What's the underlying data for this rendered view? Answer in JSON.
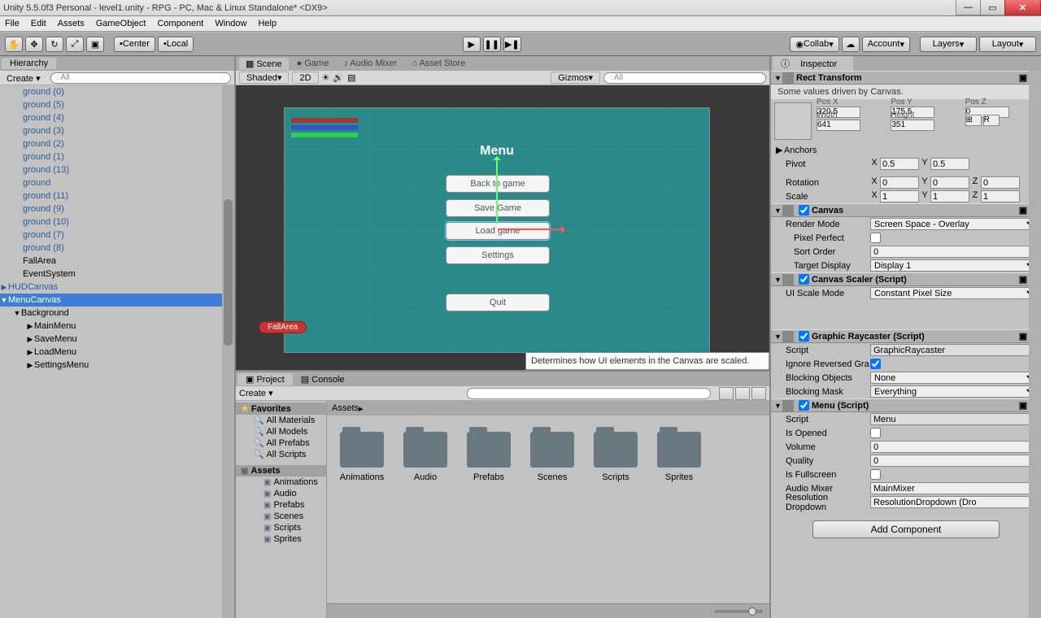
{
  "title": "Unity 5.5.0f3 Personal - level1.unity - RPG - PC, Mac & Linux Standalone* <DX9>",
  "menubar": [
    "File",
    "Edit",
    "Assets",
    "GameObject",
    "Component",
    "Window",
    "Help"
  ],
  "toolbar": {
    "center": "Center",
    "local": "Local",
    "collab": "Collab",
    "account": "Account",
    "layers": "Layers",
    "layout": "Layout"
  },
  "hierarchy": {
    "tab": "Hierarchy",
    "create": "Create",
    "search_ph": "All",
    "items": [
      {
        "t": "ground (0)",
        "c": "prefab",
        "i": 1
      },
      {
        "t": "ground (5)",
        "c": "prefab",
        "i": 1
      },
      {
        "t": "ground (4)",
        "c": "prefab",
        "i": 1
      },
      {
        "t": "ground (3)",
        "c": "prefab",
        "i": 1
      },
      {
        "t": "ground (2)",
        "c": "prefab",
        "i": 1
      },
      {
        "t": "ground (1)",
        "c": "prefab",
        "i": 1
      },
      {
        "t": "ground (13)",
        "c": "prefab",
        "i": 1
      },
      {
        "t": "ground",
        "c": "prefab",
        "i": 1
      },
      {
        "t": "ground (11)",
        "c": "prefab",
        "i": 1
      },
      {
        "t": "ground (9)",
        "c": "prefab",
        "i": 1
      },
      {
        "t": "ground (10)",
        "c": "prefab",
        "i": 1
      },
      {
        "t": "ground (7)",
        "c": "prefab",
        "i": 1
      },
      {
        "t": "ground (8)",
        "c": "prefab",
        "i": 1
      },
      {
        "t": "FallArea",
        "i": 1
      },
      {
        "t": "EventSystem",
        "i": 1
      },
      {
        "t": "HUDCanvas",
        "c": "prefab",
        "i": 0,
        "a": "▶"
      },
      {
        "t": "MenuCanvas",
        "i": 0,
        "a": "▼",
        "sel": true
      },
      {
        "t": "Background",
        "i": 1,
        "a": "▼"
      },
      {
        "t": "MainMenu",
        "i": 2,
        "a": "▶"
      },
      {
        "t": "SaveMenu",
        "i": 2,
        "a": "▶"
      },
      {
        "t": "LoadMenu",
        "i": 2,
        "a": "▶"
      },
      {
        "t": "SettingsMenu",
        "i": 2,
        "a": "▶"
      }
    ]
  },
  "view": {
    "tabs": [
      "Scene",
      "Game",
      "Audio Mixer",
      "Asset Store"
    ],
    "shading": "Shaded",
    "mode": "2D",
    "gizmos": "Gizmos",
    "search_ph": "All",
    "menu_title": "Menu",
    "buttons": [
      "Back to game",
      "Save Game",
      "Load game",
      "Settings",
      "Quit"
    ],
    "fallarea": "FallArea",
    "tooltip": "Determines how UI elements in the Canvas are scaled."
  },
  "project": {
    "tabs": [
      "Project",
      "Console"
    ],
    "create": "Create",
    "favorites": "Favorites",
    "fav_items": [
      "All Materials",
      "All Models",
      "All Prefabs",
      "All Scripts"
    ],
    "assets": "Assets",
    "asset_items": [
      "Animations",
      "Audio",
      "Prefabs",
      "Scenes",
      "Scripts",
      "Sprites"
    ],
    "breadcrumb": "Assets",
    "folders": [
      "Animations",
      "Audio",
      "Prefabs",
      "Scenes",
      "Scripts",
      "Sprites"
    ]
  },
  "inspector": {
    "tab": "Inspector",
    "rect": {
      "title": "Rect Transform",
      "note": "Some values driven by Canvas.",
      "posx": "320.5",
      "posy": "175.5",
      "posz": "0",
      "width": "641",
      "height": "351",
      "pivotx": "0.5",
      "pivoty": "0.5",
      "rotx": "0",
      "roty": "0",
      "rotz": "0",
      "sx": "1",
      "sy": "1",
      "sz": "1",
      "anchors": "Anchors",
      "pivot": "Pivot",
      "rotation": "Rotation",
      "scale": "Scale",
      "lposx": "Pos X",
      "lposy": "Pos Y",
      "lposz": "Pos Z",
      "lw": "Width",
      "lh": "Height"
    },
    "canvas": {
      "title": "Canvas",
      "render": "Render Mode",
      "render_v": "Screen Space - Overlay",
      "pixel": "Pixel Perfect",
      "sort": "Sort Order",
      "sort_v": "0",
      "target": "Target Display",
      "target_v": "Display 1"
    },
    "scaler": {
      "title": "Canvas Scaler (Script)",
      "mode": "UI Scale Mode",
      "mode_v": "Constant Pixel Size"
    },
    "raycaster": {
      "title": "Graphic Raycaster (Script)",
      "script": "Script",
      "script_v": "GraphicRaycaster",
      "ignore": "Ignore Reversed Gra",
      "block": "Blocking Objects",
      "block_v": "None",
      "mask": "Blocking Mask",
      "mask_v": "Everything"
    },
    "menu": {
      "title": "Menu (Script)",
      "script": "Script",
      "script_v": "Menu",
      "opened": "Is Opened",
      "volume": "Volume",
      "volume_v": "0",
      "quality": "Quality",
      "quality_v": "0",
      "fullscreen": "Is Fullscreen",
      "mixer": "Audio Mixer",
      "mixer_v": "MainMixer",
      "res": "Resolution Dropdown",
      "res_v": "ResolutionDropdown (Dro"
    },
    "add": "Add Component"
  }
}
